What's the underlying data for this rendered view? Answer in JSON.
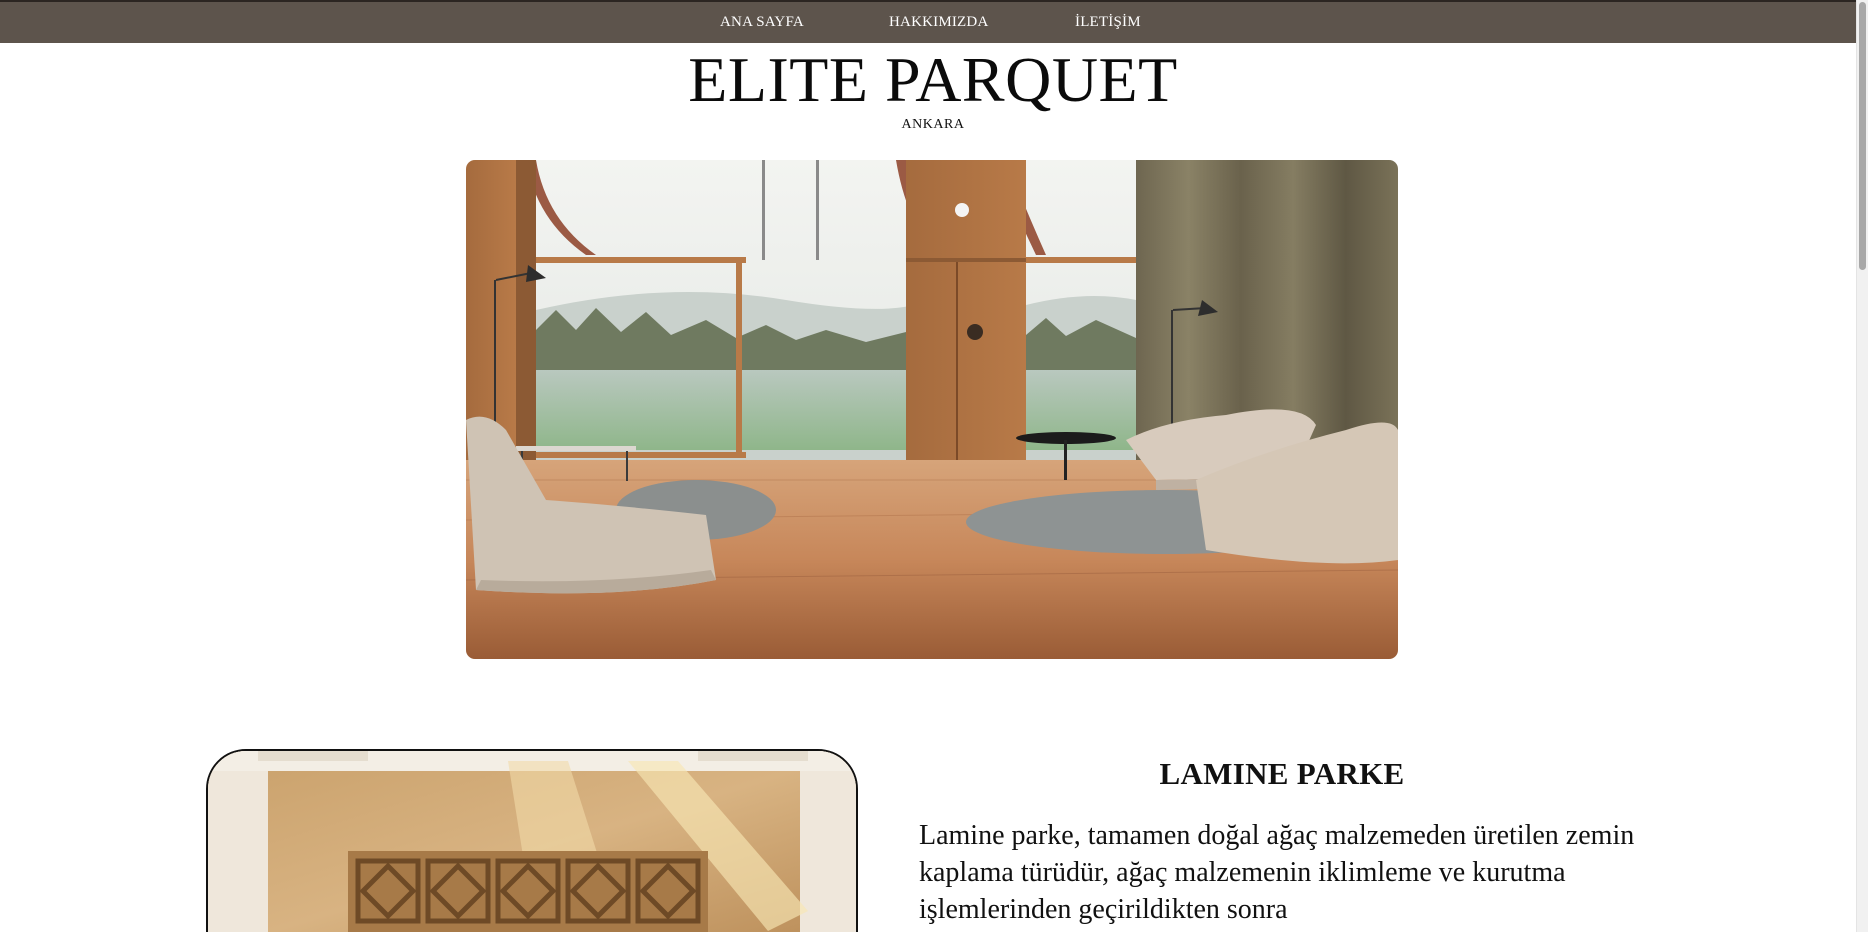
{
  "nav": {
    "items": [
      {
        "label": "ANA SAYFA"
      },
      {
        "label": "HAKKIMIZDA"
      },
      {
        "label": "İLETİŞİM"
      }
    ]
  },
  "brand": {
    "title": "ELITE PARQUET",
    "city": "ANKARA"
  },
  "hero": {
    "image": "living-room-wood-floor-photo"
  },
  "section": {
    "image": "parquet-floor-pattern-photo",
    "title": "LAMINE PARKE",
    "text": "Lamine parke, tamamen doğal ağaç malzemeden üretilen zemin kaplama türüdür, ağaç malzemenin iklimleme ve kurutma işlemlerinden geçirildikten sonra"
  },
  "colors": {
    "navbar": "#5d544c",
    "text": "#111111",
    "background": "#ffffff"
  }
}
